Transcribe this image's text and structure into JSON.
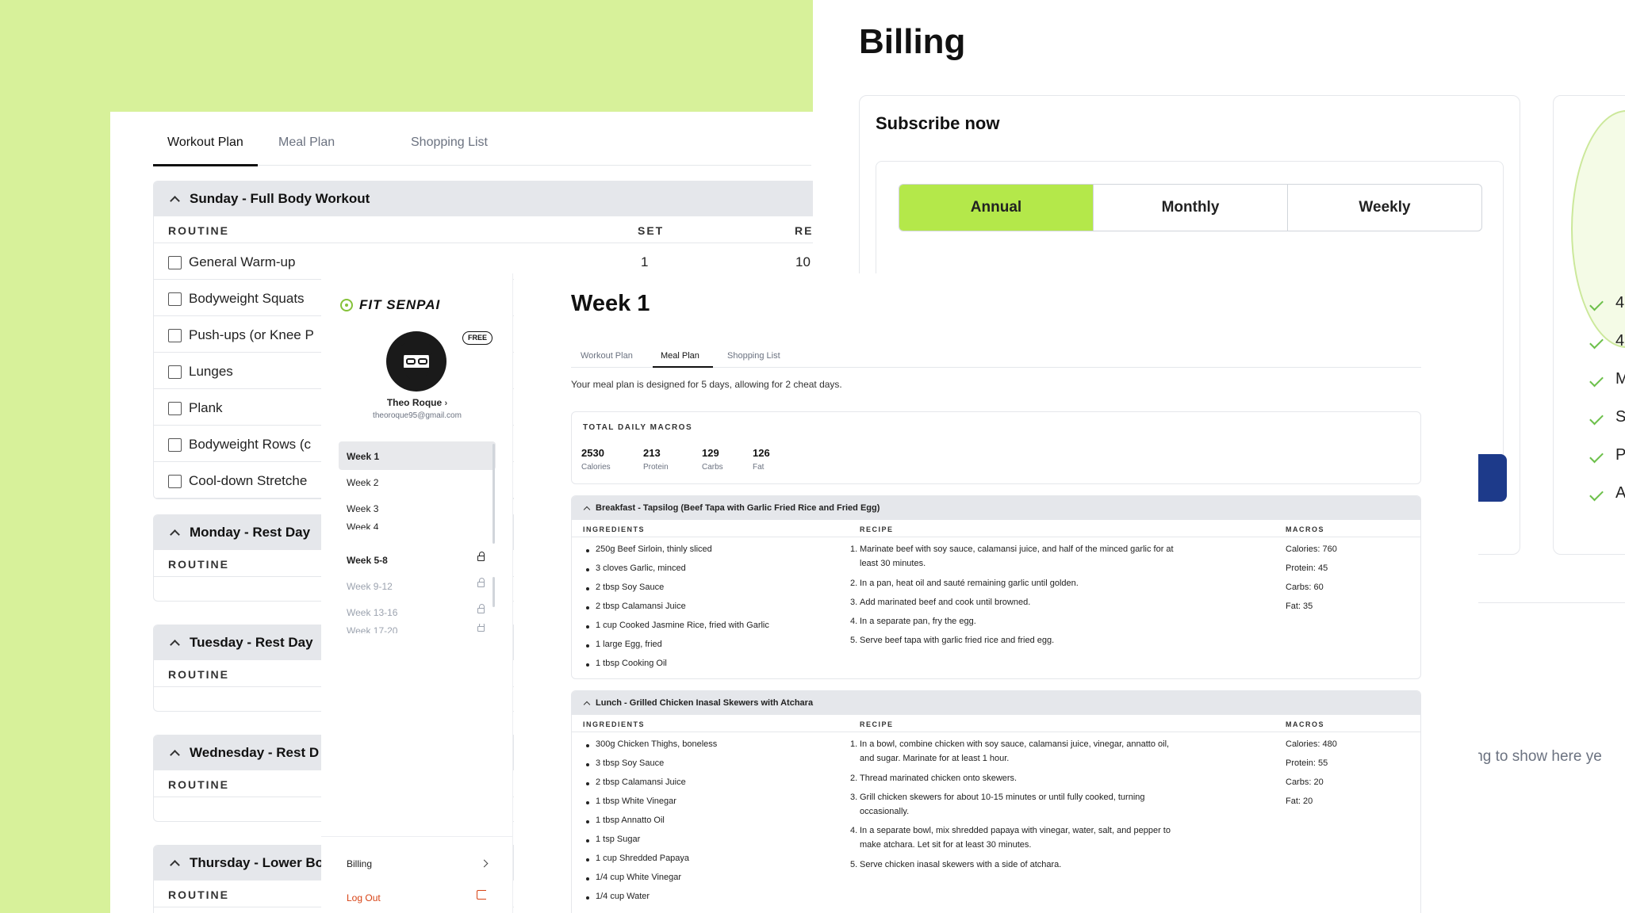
{
  "workout_panel": {
    "tabs": [
      "Workout Plan",
      "Meal Plan",
      "Shopping List"
    ],
    "days": [
      {
        "title": "Sunday - Full Body Workout",
        "col_routine": "ROUTINE",
        "col_set": "SET",
        "col_rep": "RE",
        "exercises": [
          {
            "name": "General Warm-up",
            "set": "1",
            "rep": "10"
          },
          {
            "name": "Bodyweight Squats"
          },
          {
            "name": "Push-ups (or Knee P"
          },
          {
            "name": "Lunges"
          },
          {
            "name": "Plank"
          },
          {
            "name": "Bodyweight Rows (c"
          },
          {
            "name": "Cool-down Stretche"
          }
        ]
      },
      {
        "title": "Monday - Rest Day",
        "col_routine": "ROUTINE"
      },
      {
        "title": "Tuesday - Rest Day",
        "col_routine": "ROUTINE"
      },
      {
        "title": "Wednesday - Rest D",
        "col_routine": "ROUTINE"
      },
      {
        "title": "Thursday - Lower Bo",
        "col_routine": "ROUTINE"
      }
    ]
  },
  "billing": {
    "title": "Billing",
    "subscribe_title": "Subscribe now",
    "plans": [
      "Annual",
      "Monthly",
      "Weekly"
    ],
    "selected_plan": "Annual",
    "features": [
      "4",
      "4",
      "M",
      "S",
      "P",
      "A"
    ],
    "empty_text": "ing to show here ye"
  },
  "sidebar": {
    "logo": "FIT SENPAI",
    "badge": "FREE",
    "user_name": "Theo Roque",
    "user_email": "theoroque95@gmail.com",
    "weeks": [
      "Week 1",
      "Week 2",
      "Week 3",
      "Week 4"
    ],
    "locked": [
      "Week 5-8",
      "Week 9-12",
      "Week 13-16",
      "Week 17-20"
    ],
    "billing": "Billing",
    "logout": "Log Out"
  },
  "main": {
    "title": "Week 1",
    "tabs": [
      "Workout Plan",
      "Meal Plan",
      "Shopping List"
    ],
    "description": "Your meal plan is designed for 5 days, allowing for 2 cheat days.",
    "macros_title": "TOTAL DAILY MACROS",
    "macros": [
      {
        "value": "2530",
        "label": "Calories"
      },
      {
        "value": "213",
        "label": "Protein"
      },
      {
        "value": "129",
        "label": "Carbs"
      },
      {
        "value": "126",
        "label": "Fat"
      }
    ],
    "col_ingredients": "INGREDIENTS",
    "col_recipe": "RECIPE",
    "col_macros": "MACROS",
    "meals": [
      {
        "title": "Breakfast - Tapsilog (Beef Tapa with Garlic Fried Rice and Fried Egg)",
        "ingredients": [
          "250g Beef Sirloin, thinly sliced",
          "3 cloves Garlic, minced",
          "2 tbsp Soy Sauce",
          "2 tbsp Calamansi Juice",
          "1 cup Cooked Jasmine Rice, fried with Garlic",
          "1 large Egg, fried",
          "1 tbsp Cooking Oil"
        ],
        "steps": [
          "Marinate beef with soy sauce, calamansi juice, and half of the minced garlic for at least 30 minutes.",
          "In a pan, heat oil and sauté remaining garlic until golden.",
          "Add marinated beef and cook until browned.",
          "In a separate pan, fry the egg.",
          "Serve beef tapa with garlic fried rice and fried egg."
        ],
        "macros": [
          "Calories: 760",
          "Protein: 45",
          "Carbs: 60",
          "Fat: 35"
        ]
      },
      {
        "title": "Lunch - Grilled Chicken Inasal Skewers with Atchara",
        "ingredients": [
          "300g Chicken Thighs, boneless",
          "3 tbsp Soy Sauce",
          "2 tbsp Calamansi Juice",
          "1 tbsp White Vinegar",
          "1 tbsp Annatto Oil",
          "1 tsp Sugar",
          "1 cup Shredded Papaya",
          "1/4 cup White Vinegar",
          "1/4 cup Water"
        ],
        "steps": [
          "In a bowl, combine chicken with soy sauce, calamansi juice, vinegar, annatto oil, and sugar. Marinate for at least 1 hour.",
          "Thread marinated chicken onto skewers.",
          "Grill chicken skewers for about 10-15 minutes or until fully cooked, turning occasionally.",
          "In a separate bowl, mix shredded papaya with vinegar, water, salt, and pepper to make atchara. Let sit for at least 30 minutes.",
          "Serve chicken inasal skewers with a side of atchara."
        ],
        "macros": [
          "Calories: 480",
          "Protein: 55",
          "Carbs: 20",
          "Fat: 20"
        ]
      }
    ]
  }
}
